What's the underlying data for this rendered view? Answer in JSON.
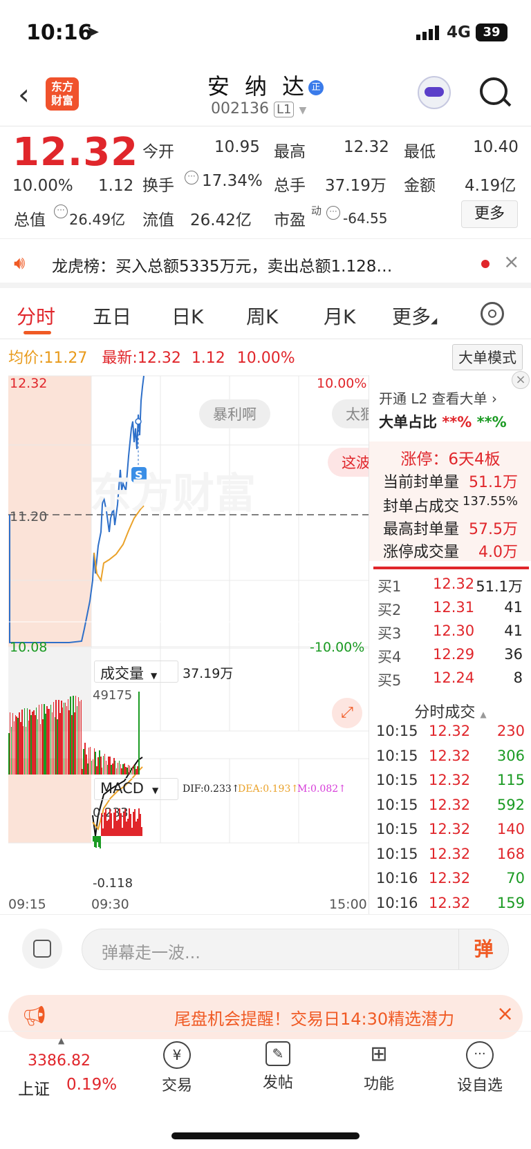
{
  "status": {
    "time": "10:16",
    "network": "4G",
    "battery": "39"
  },
  "header": {
    "name": "安 纳 达",
    "code": "002136",
    "level": "L1",
    "logo_line1": "东方",
    "logo_line2": "财富"
  },
  "quote": {
    "price": "12.32",
    "pct": "10.00%",
    "chg": "1.12",
    "open_label": "今开",
    "open": "10.95",
    "high_label": "最高",
    "high": "12.32",
    "low_label": "最低",
    "low": "10.40",
    "turnover_label": "换手",
    "turnover": "17.34%",
    "vol_label": "总手",
    "vol": "37.19万",
    "amt_label": "金额",
    "amt": "4.19亿",
    "mcap_label": "总值",
    "mcap": "26.49亿",
    "float_label": "流值",
    "float": "26.42亿",
    "pe_label": "市盈",
    "pe_sup": "动",
    "pe": "-64.55",
    "more": "更多"
  },
  "banner": {
    "text": "龙虎榜：买入总额5335万元，卖出总额1.128…"
  },
  "tabs": [
    "分时",
    "五日",
    "日K",
    "周K",
    "月K",
    "更多"
  ],
  "avg": {
    "avg_label": "均价:",
    "avg": "11.27",
    "last_label": "最新:",
    "last": "12.32",
    "chg": "1.12",
    "pct": "10.00%",
    "mode": "大单模式"
  },
  "chart": {
    "ymax": "12.32",
    "ymid": "11.20",
    "ymin": "10.08",
    "pmax": "10.00%",
    "pmin": "-10.00%",
    "danmu1": "暴利啊",
    "danmu2": "太狠",
    "danmu3": "这波",
    "vol_select": "成交量",
    "vol_total": "37.19万",
    "vol_max": "49175",
    "macd_select": "MACD",
    "dif": "DIF:0.233↑",
    "dea": "DEA:0.193↑",
    "m": "M:0.082↑",
    "macd_top": "0.233",
    "macd_bot": "-0.118",
    "t_start": "09:15",
    "t_open": "09:30",
    "t_end": "15:00"
  },
  "right": {
    "l2": "开通 L2 查看大单 ›",
    "bigratio_label": "大单占比",
    "bigratio_v1": "**%",
    "bigratio_v2": "**%",
    "limit": "涨停：6天4板",
    "seal_label": "当前封单量",
    "seal": "51.1万",
    "seal_ratio_label": "封单占成交",
    "seal_ratio": "137.55%",
    "max_seal_label": "最高封单量",
    "max_seal": "57.5万",
    "limit_vol_label": "涨停成交量",
    "limit_vol": "4.0万",
    "bids": [
      {
        "l": "买1",
        "p": "12.32",
        "v": "51.1万"
      },
      {
        "l": "买2",
        "p": "12.31",
        "v": "41"
      },
      {
        "l": "买3",
        "p": "12.30",
        "v": "41"
      },
      {
        "l": "买4",
        "p": "12.29",
        "v": "36"
      },
      {
        "l": "买5",
        "p": "12.24",
        "v": "8"
      }
    ],
    "ticks_title": "分时成交",
    "ticks": [
      {
        "t": "10:15",
        "p": "12.32",
        "v": "230",
        "c": "red"
      },
      {
        "t": "10:15",
        "p": "12.32",
        "v": "306",
        "c": "green"
      },
      {
        "t": "10:15",
        "p": "12.32",
        "v": "115",
        "c": "green"
      },
      {
        "t": "10:15",
        "p": "12.32",
        "v": "592",
        "c": "green"
      },
      {
        "t": "10:15",
        "p": "12.32",
        "v": "140",
        "c": "red"
      },
      {
        "t": "10:15",
        "p": "12.32",
        "v": "168",
        "c": "red"
      },
      {
        "t": "10:16",
        "p": "12.32",
        "v": "70",
        "c": "green"
      },
      {
        "t": "10:16",
        "p": "12.32",
        "v": "159",
        "c": "green"
      }
    ]
  },
  "input": {
    "placeholder": "弹幕走一波...",
    "dan": "弹"
  },
  "promo": {
    "text": "尾盘机会提醒！交易日14:30精选潜力"
  },
  "footer": {
    "index_val": "3386.82",
    "index_name": "上证",
    "index_pct": "0.19%",
    "trade": "交易",
    "post": "发帖",
    "func": "功能",
    "watch": "设自选"
  }
}
